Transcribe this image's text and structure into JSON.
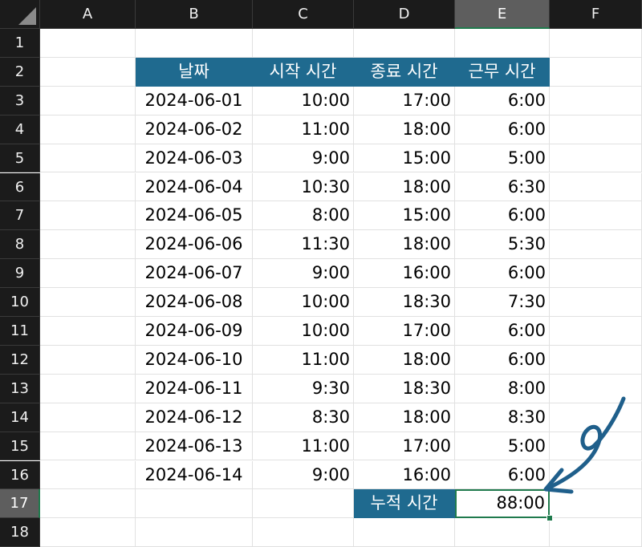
{
  "columns": [
    "A",
    "B",
    "C",
    "D",
    "E",
    "F"
  ],
  "selected_column": "E",
  "rows": [
    "1",
    "2",
    "3",
    "4",
    "5",
    "6",
    "7",
    "8",
    "9",
    "10",
    "11",
    "12",
    "13",
    "14",
    "15",
    "16",
    "17",
    "18"
  ],
  "selected_row": "17",
  "table": {
    "headers": [
      "날짜",
      "시작 시간",
      "종료 시간",
      "근무 시간"
    ],
    "records": [
      [
        "2024-06-01",
        "10:00",
        "17:00",
        "6:00"
      ],
      [
        "2024-06-02",
        "11:00",
        "18:00",
        "6:00"
      ],
      [
        "2024-06-03",
        "9:00",
        "15:00",
        "5:00"
      ],
      [
        "2024-06-04",
        "10:30",
        "18:00",
        "6:30"
      ],
      [
        "2024-06-05",
        "8:00",
        "15:00",
        "6:00"
      ],
      [
        "2024-06-06",
        "11:30",
        "18:00",
        "5:30"
      ],
      [
        "2024-06-07",
        "9:00",
        "16:00",
        "6:00"
      ],
      [
        "2024-06-08",
        "10:00",
        "18:30",
        "7:30"
      ],
      [
        "2024-06-09",
        "10:00",
        "17:00",
        "6:00"
      ],
      [
        "2024-06-10",
        "11:00",
        "18:00",
        "6:00"
      ],
      [
        "2024-06-11",
        "9:30",
        "18:30",
        "8:00"
      ],
      [
        "2024-06-12",
        "8:30",
        "18:00",
        "8:30"
      ],
      [
        "2024-06-13",
        "11:00",
        "17:00",
        "5:00"
      ],
      [
        "2024-06-14",
        "9:00",
        "16:00",
        "6:00"
      ]
    ]
  },
  "total": {
    "label": "누적 시간",
    "value": "88:00"
  },
  "colors": {
    "header_fill": "#1f6a8f",
    "selection": "#1f7a4d",
    "annotation": "#1f5f8b",
    "chrome": "#1b1b1b"
  },
  "annotation": {
    "icon": "hand-drawn-arrow-icon"
  }
}
